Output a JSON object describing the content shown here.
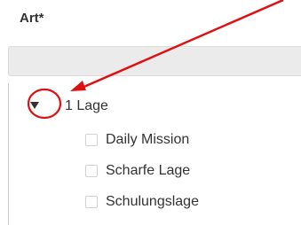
{
  "field": {
    "label": "Art*"
  },
  "filter": {
    "value": ""
  },
  "tree": {
    "group_label": "1 Lage",
    "toggle_icon": "caret-down-icon",
    "options": [
      {
        "label": "Daily Mission",
        "checked": false
      },
      {
        "label": "Scharfe Lage",
        "checked": false
      },
      {
        "label": "Schulungslage",
        "checked": false
      }
    ]
  },
  "annotation": {
    "color": "#e01010",
    "arrow_icon": "annotation-arrow",
    "circle_icon": "annotation-circle"
  }
}
